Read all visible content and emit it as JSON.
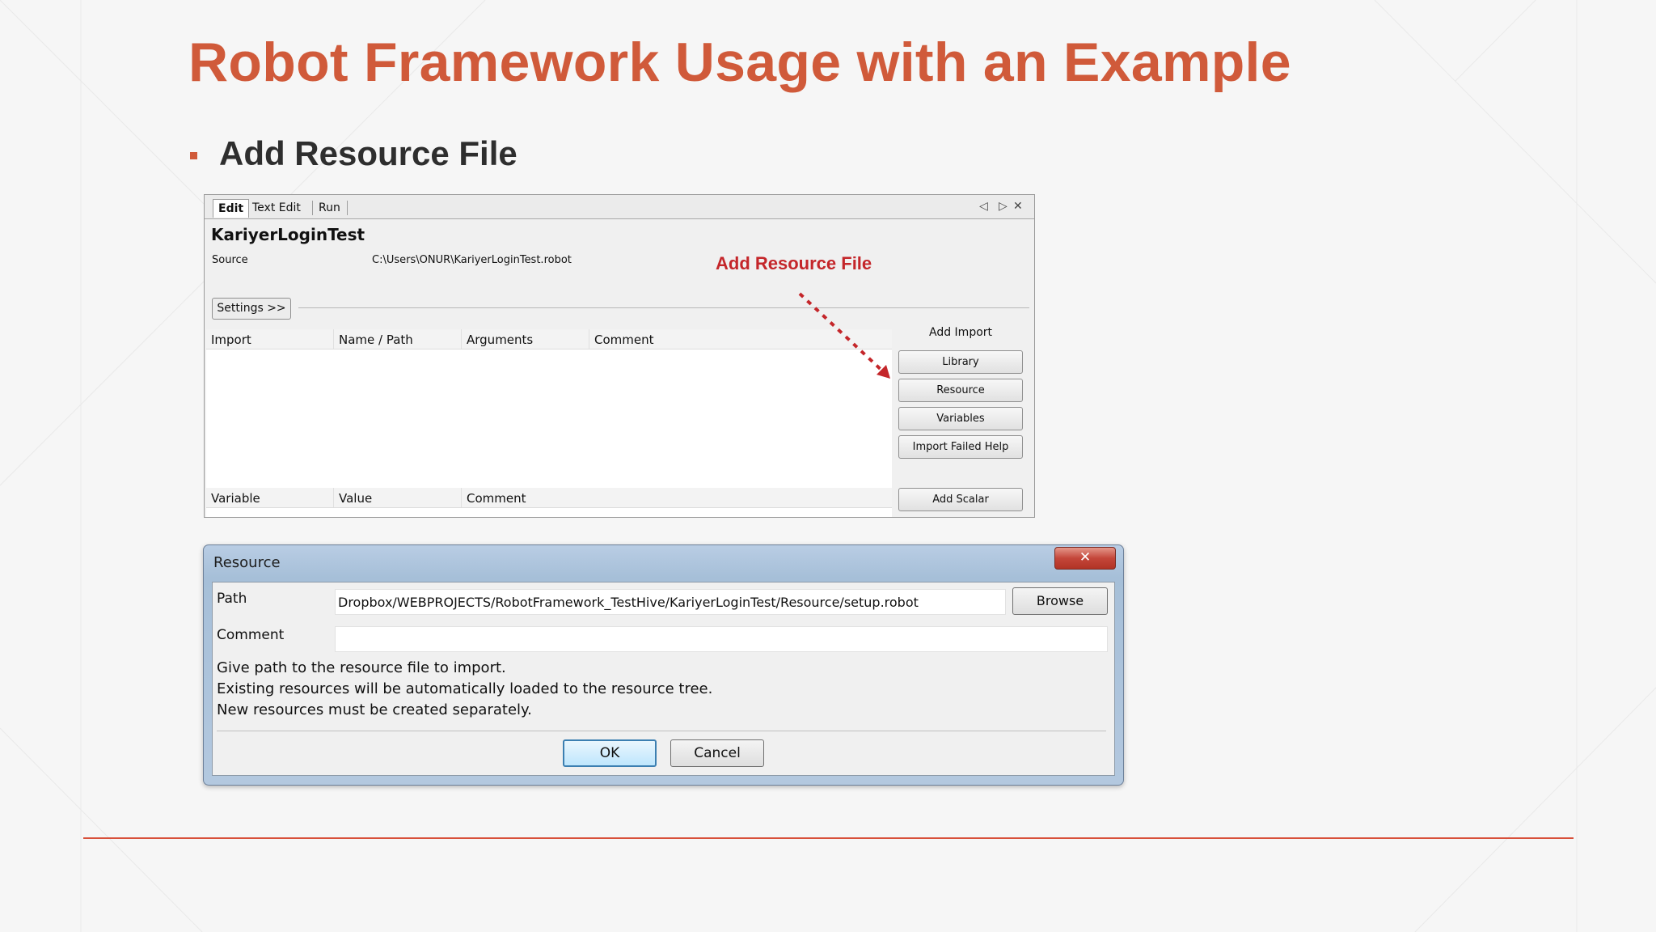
{
  "slide": {
    "title": "Robot Framework Usage with an Example",
    "bullet": "Add Resource File",
    "accent_color": "#d05a3a",
    "footer_line_color": "#d8503a"
  },
  "editor": {
    "tabs": [
      "Edit",
      "Text Edit",
      "Run"
    ],
    "window_controls": {
      "prev": "◁",
      "next": "▷",
      "close": "✕"
    },
    "test_name": "KariyerLoginTest",
    "source_label": "Source",
    "source_path": "C:\\Users\\ONUR\\KariyerLoginTest.robot",
    "settings_button": "Settings >>",
    "import_columns": [
      "Import",
      "Name / Path",
      "Arguments",
      "Comment"
    ],
    "variable_columns": [
      "Variable",
      "Value",
      "Comment"
    ],
    "add_import_label": "Add Import",
    "buttons": {
      "library": "Library",
      "resource": "Resource",
      "variables": "Variables",
      "import_failed_help": "Import Failed Help",
      "add_scalar": "Add Scalar"
    }
  },
  "callout": {
    "text": "Add Resource File",
    "color": "#c4262a"
  },
  "dialog": {
    "title": "Resource",
    "close": "✕",
    "path_label": "Path",
    "path_value": "Dropbox/WEBPROJECTS/RobotFramework_TestHive/KariyerLoginTest/Resource/setup.robot",
    "comment_label": "Comment",
    "comment_value": "",
    "browse_button": "Browse",
    "help_lines": [
      "Give path to the resource file to import.",
      "Existing resources will be automatically loaded to the resource tree.",
      "New resources must be created separately."
    ],
    "ok_button": "OK",
    "cancel_button": "Cancel"
  }
}
